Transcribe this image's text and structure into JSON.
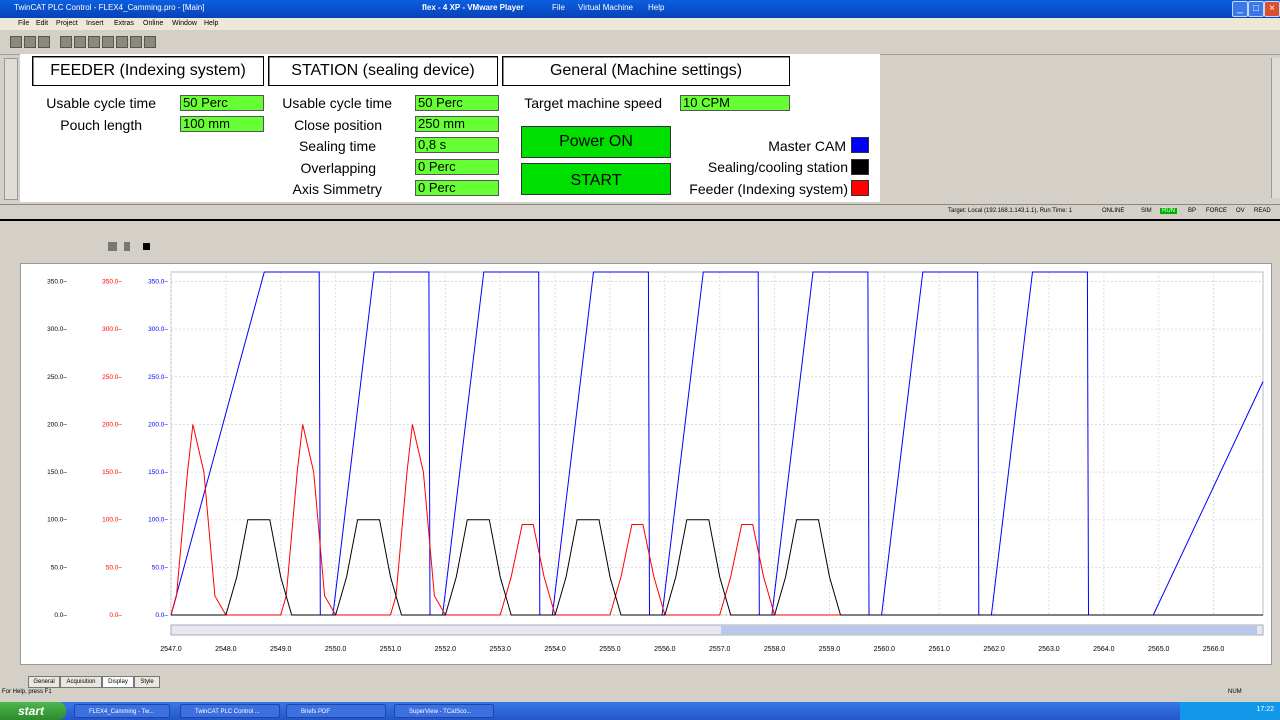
{
  "window": {
    "title": "TwinCAT PLC Control - FLEX4_Camming.pro - [Main]",
    "vmware_title": "flex - 4 XP - VMware Player",
    "vmware_menu": [
      "File",
      "Virtual Machine",
      "Help"
    ]
  },
  "menubar": [
    "File",
    "Edit",
    "Project",
    "Insert",
    "Extras",
    "Online",
    "Window",
    "Help"
  ],
  "feeder": {
    "header": "FEEDER (Indexing system)",
    "rows": [
      {
        "label": "Usable cycle time",
        "value": "50 Perc"
      },
      {
        "label": "Pouch length",
        "value": "100 mm"
      }
    ]
  },
  "station": {
    "header": "STATION (sealing device)",
    "rows": [
      {
        "label": "Usable cycle time",
        "value": "50 Perc"
      },
      {
        "label": "Close position",
        "value": "250 mm"
      },
      {
        "label": "Sealing time",
        "value": "0,8 s"
      },
      {
        "label": "Overlapping",
        "value": "0 Perc"
      },
      {
        "label": "Axis Simmetry",
        "value": "0 Perc"
      }
    ]
  },
  "general": {
    "header": "General (Machine settings)",
    "speed_label": "Target machine speed",
    "speed_value": "10 CPM",
    "power_button": "Power ON",
    "start_button": "START"
  },
  "legend": [
    {
      "label": "Master CAM",
      "color": "#0000ff"
    },
    {
      "label": "Sealing/cooling station",
      "color": "#000000"
    },
    {
      "label": "Feeder (Indexing system)",
      "color": "#ff0000"
    }
  ],
  "status": {
    "target": "Target: Local (192.168.1.143.1.1), Run Time: 1",
    "online": "ONLINE",
    "flags": [
      "SIM",
      "RUN",
      "BP",
      "FORCE",
      "OV",
      "READ"
    ],
    "help": "For Help, press F1",
    "num": "NUM"
  },
  "scope_tabs": [
    "General",
    "Acquisition",
    "Display",
    "Style"
  ],
  "taskbar": {
    "start": "start",
    "tasks": [
      "FLEX4_Camming - Tw...",
      "TwinCAT PLC Control ...",
      "Briefs PDF",
      "SuperView - TCatSco..."
    ],
    "clock": "17:22"
  },
  "chart_data": {
    "type": "line",
    "xlim": [
      2547.0,
      2566.9
    ],
    "ylim": [
      0,
      360
    ],
    "x_ticks": [
      2547.0,
      2548.0,
      2549.0,
      2550.0,
      2551.0,
      2552.0,
      2553.0,
      2554.0,
      2555.0,
      2556.0,
      2557.0,
      2558.0,
      2559.0,
      2560.0,
      2561.0,
      2562.0,
      2563.0,
      2564.0,
      2565.0,
      2566.0
    ],
    "y_ticks": [
      0.0,
      50.0,
      100.0,
      150.0,
      200.0,
      250.0,
      300.0,
      350.0
    ],
    "y_axis_colors": [
      "#000000",
      "#ff0000",
      "#0000ff"
    ],
    "series": [
      {
        "color": "#0000ff",
        "x": [
          2547.0,
          2548.7,
          2548.7,
          2549.7,
          2549.72,
          2549.95,
          2550.7,
          2550.7,
          2551.7,
          2551.72,
          2551.95,
          2552.7,
          2552.7,
          2553.7,
          2553.72,
          2553.95,
          2554.7,
          2554.7,
          2555.7,
          2555.72,
          2555.95,
          2556.7,
          2556.7,
          2557.7,
          2557.72,
          2557.95,
          2558.7,
          2558.7,
          2559.7,
          2559.72,
          2559.95,
          2560.7,
          2560.7,
          2561.7,
          2561.72,
          2561.95,
          2562.7,
          2562.7,
          2563.7,
          2563.72,
          2563.95,
          2564.9,
          2564.9,
          2566.9
        ],
        "y": [
          0,
          360,
          360,
          360,
          0,
          0,
          360,
          360,
          360,
          0,
          0,
          360,
          360,
          360,
          0,
          0,
          360,
          360,
          360,
          0,
          0,
          360,
          360,
          360,
          0,
          0,
          360,
          360,
          360,
          0,
          0,
          360,
          360,
          360,
          0,
          0,
          360,
          360,
          360,
          0,
          0,
          0,
          0,
          245
        ]
      },
      {
        "color": "#ff0000",
        "x": [
          2547.0,
          2547.1,
          2547.3,
          2547.4,
          2547.6,
          2547.8,
          2548.0,
          2548.2,
          2549.0,
          2549.1,
          2549.3,
          2549.4,
          2549.6,
          2549.8,
          2550.0,
          2550.2,
          2551.0,
          2551.1,
          2551.3,
          2551.4,
          2551.6,
          2551.8,
          2552.0,
          2552.2,
          2553.0,
          2553.2,
          2553.4,
          2553.6,
          2553.8,
          2554.0,
          2555.0,
          2555.2,
          2555.4,
          2555.6,
          2555.8,
          2556.0,
          2557.0,
          2557.2,
          2557.4,
          2557.6,
          2557.8,
          2558.0,
          2566.9
        ],
        "y": [
          0,
          20,
          150,
          200,
          150,
          20,
          0,
          0,
          0,
          20,
          150,
          200,
          150,
          20,
          0,
          0,
          0,
          20,
          150,
          200,
          150,
          20,
          0,
          0,
          0,
          40,
          95,
          95,
          40,
          0,
          0,
          40,
          95,
          95,
          40,
          0,
          0,
          40,
          95,
          95,
          40,
          0,
          0
        ]
      },
      {
        "color": "#000000",
        "x": [
          2547.0,
          2548.0,
          2548.2,
          2548.4,
          2548.8,
          2549.0,
          2549.2,
          2550.0,
          2550.2,
          2550.4,
          2550.8,
          2551.0,
          2551.2,
          2552.0,
          2552.2,
          2552.4,
          2552.8,
          2553.0,
          2553.2,
          2554.0,
          2554.2,
          2554.4,
          2554.8,
          2555.0,
          2555.2,
          2556.0,
          2556.2,
          2556.4,
          2556.8,
          2557.0,
          2557.2,
          2558.0,
          2558.2,
          2558.4,
          2558.8,
          2559.0,
          2559.2,
          2566.9
        ],
        "y": [
          0,
          0,
          40,
          100,
          100,
          40,
          0,
          0,
          40,
          100,
          100,
          40,
          0,
          0,
          40,
          100,
          100,
          40,
          0,
          0,
          40,
          100,
          100,
          40,
          0,
          0,
          40,
          100,
          100,
          40,
          0,
          0,
          40,
          100,
          100,
          40,
          0,
          0
        ]
      }
    ]
  }
}
